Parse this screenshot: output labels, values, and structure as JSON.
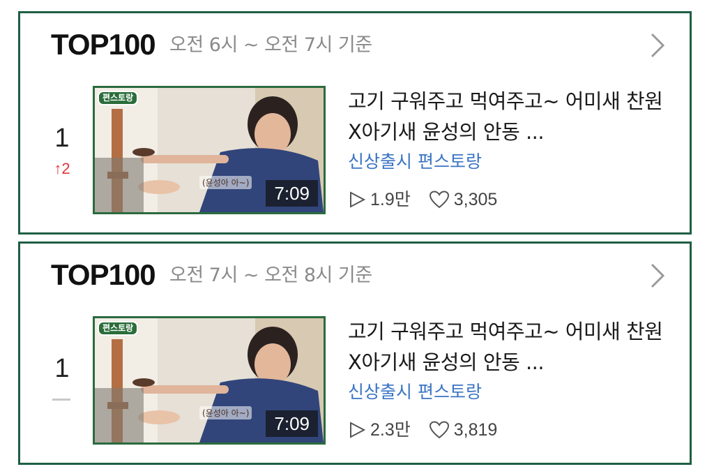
{
  "cards": [
    {
      "title": "TOP100",
      "time_range": "오전 6시 ~ 오전 7시 기준",
      "rank": "1",
      "rank_change": "↑2",
      "video": {
        "title": "고기 구워주고 먹여주고~ 어미새 찬원X아기새 윤성의 안동 ...",
        "channel": "신상출시 편스토랑",
        "duration": "7:09",
        "views": "1.9만",
        "likes": "3,305",
        "thumb_logo": "편스토랑",
        "thumb_caption": "(윤성아 아~)"
      }
    },
    {
      "title": "TOP100",
      "time_range": "오전 7시 ~ 오전 8시 기준",
      "rank": "1",
      "rank_change": "",
      "video": {
        "title": "고기 구워주고 먹여주고~ 어미새 찬원X아기새 윤성의 안동 ...",
        "channel": "신상출시 편스토랑",
        "duration": "7:09",
        "views": "2.3만",
        "likes": "3,819",
        "thumb_logo": "편스토랑",
        "thumb_caption": "(윤성아 아~)"
      }
    }
  ],
  "icons": {
    "chevron": "chevron-right-icon",
    "play": "play-icon",
    "heart": "heart-icon"
  },
  "colors": {
    "border": "#1f5e45",
    "rank_up": "#e0373a",
    "channel": "#3a74c4"
  }
}
